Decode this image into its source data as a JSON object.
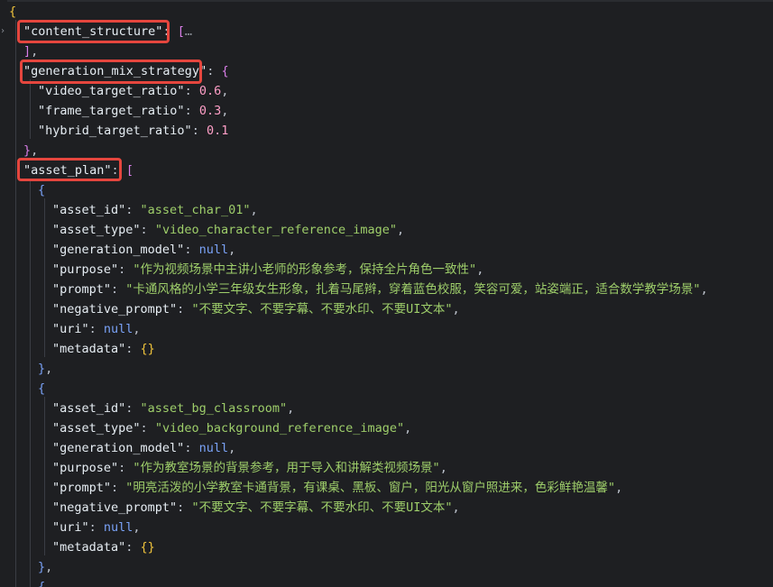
{
  "lines": [
    {
      "id": "l0",
      "parts": [
        {
          "t": "{",
          "c": "brace-y"
        }
      ]
    },
    {
      "id": "l1",
      "parts": [
        {
          "t": "\"content_structure\"",
          "c": "key"
        },
        {
          "t": ": ",
          "c": "punc"
        },
        {
          "t": "[",
          "c": "brack-p"
        },
        {
          "t": "…",
          "c": "ellipsis"
        }
      ]
    },
    {
      "id": "l2",
      "parts": [
        {
          "t": "]",
          "c": "brack-p"
        },
        {
          "t": ",",
          "c": "punc"
        }
      ]
    },
    {
      "id": "l3",
      "parts": [
        {
          "t": "\"generation_mix_strategy\"",
          "c": "key"
        },
        {
          "t": ": ",
          "c": "punc"
        },
        {
          "t": "{",
          "c": "brace-p"
        }
      ]
    },
    {
      "id": "l4",
      "parts": [
        {
          "t": "\"video_target_ratio\"",
          "c": "key"
        },
        {
          "t": ": ",
          "c": "punc"
        },
        {
          "t": "0.6",
          "c": "num"
        },
        {
          "t": ",",
          "c": "punc"
        }
      ]
    },
    {
      "id": "l5",
      "parts": [
        {
          "t": "\"frame_target_ratio\"",
          "c": "key"
        },
        {
          "t": ": ",
          "c": "punc"
        },
        {
          "t": "0.3",
          "c": "num"
        },
        {
          "t": ",",
          "c": "punc"
        }
      ]
    },
    {
      "id": "l6",
      "parts": [
        {
          "t": "\"hybrid_target_ratio\"",
          "c": "key"
        },
        {
          "t": ": ",
          "c": "punc"
        },
        {
          "t": "0.1",
          "c": "num"
        }
      ]
    },
    {
      "id": "l7",
      "parts": [
        {
          "t": "}",
          "c": "brace-p"
        },
        {
          "t": ",",
          "c": "punc"
        }
      ]
    },
    {
      "id": "l8",
      "parts": [
        {
          "t": "\"asset_plan\"",
          "c": "key"
        },
        {
          "t": ": ",
          "c": "punc"
        },
        {
          "t": "[",
          "c": "brack-p"
        }
      ]
    },
    {
      "id": "l9",
      "parts": [
        {
          "t": "{",
          "c": "brace-b"
        }
      ]
    },
    {
      "id": "l10",
      "parts": [
        {
          "t": "\"asset_id\"",
          "c": "key"
        },
        {
          "t": ": ",
          "c": "punc"
        },
        {
          "t": "\"asset_char_01\"",
          "c": "str"
        },
        {
          "t": ",",
          "c": "punc"
        }
      ]
    },
    {
      "id": "l11",
      "parts": [
        {
          "t": "\"asset_type\"",
          "c": "key"
        },
        {
          "t": ": ",
          "c": "punc"
        },
        {
          "t": "\"video_character_reference_image\"",
          "c": "str"
        },
        {
          "t": ",",
          "c": "punc"
        }
      ]
    },
    {
      "id": "l12",
      "parts": [
        {
          "t": "\"generation_model\"",
          "c": "key"
        },
        {
          "t": ": ",
          "c": "punc"
        },
        {
          "t": "null",
          "c": "nul"
        },
        {
          "t": ",",
          "c": "punc"
        }
      ]
    },
    {
      "id": "l13",
      "parts": [
        {
          "t": "\"purpose\"",
          "c": "key"
        },
        {
          "t": ": ",
          "c": "punc"
        },
        {
          "t": "\"作为视频场景中主讲小老师的形象参考，保持全片角色一致性\"",
          "c": "str"
        },
        {
          "t": ",",
          "c": "punc"
        }
      ]
    },
    {
      "id": "l14",
      "parts": [
        {
          "t": "\"prompt\"",
          "c": "key"
        },
        {
          "t": ": ",
          "c": "punc"
        },
        {
          "t": "\"卡通风格的小学三年级女生形象，扎着马尾辫，穿着蓝色校服，笑容可爱，站姿端正，适合数学教学场景\"",
          "c": "str"
        },
        {
          "t": ",",
          "c": "punc"
        }
      ]
    },
    {
      "id": "l15",
      "parts": [
        {
          "t": "\"negative_prompt\"",
          "c": "key"
        },
        {
          "t": ": ",
          "c": "punc"
        },
        {
          "t": "\"不要文字、不要字幕、不要水印、不要UI文本\"",
          "c": "str"
        },
        {
          "t": ",",
          "c": "punc"
        }
      ]
    },
    {
      "id": "l16",
      "parts": [
        {
          "t": "\"uri\"",
          "c": "key"
        },
        {
          "t": ": ",
          "c": "punc"
        },
        {
          "t": "null",
          "c": "nul"
        },
        {
          "t": ",",
          "c": "punc"
        }
      ]
    },
    {
      "id": "l17",
      "parts": [
        {
          "t": "\"metadata\"",
          "c": "key"
        },
        {
          "t": ": ",
          "c": "punc"
        },
        {
          "t": "{}",
          "c": "brace-y"
        }
      ]
    },
    {
      "id": "l18",
      "parts": [
        {
          "t": "}",
          "c": "brace-b"
        },
        {
          "t": ",",
          "c": "punc"
        }
      ]
    },
    {
      "id": "l19",
      "parts": [
        {
          "t": "{",
          "c": "brace-b"
        }
      ]
    },
    {
      "id": "l20",
      "parts": [
        {
          "t": "\"asset_id\"",
          "c": "key"
        },
        {
          "t": ": ",
          "c": "punc"
        },
        {
          "t": "\"asset_bg_classroom\"",
          "c": "str"
        },
        {
          "t": ",",
          "c": "punc"
        }
      ]
    },
    {
      "id": "l21",
      "parts": [
        {
          "t": "\"asset_type\"",
          "c": "key"
        },
        {
          "t": ": ",
          "c": "punc"
        },
        {
          "t": "\"video_background_reference_image\"",
          "c": "str"
        },
        {
          "t": ",",
          "c": "punc"
        }
      ]
    },
    {
      "id": "l22",
      "parts": [
        {
          "t": "\"generation_model\"",
          "c": "key"
        },
        {
          "t": ": ",
          "c": "punc"
        },
        {
          "t": "null",
          "c": "nul"
        },
        {
          "t": ",",
          "c": "punc"
        }
      ]
    },
    {
      "id": "l23",
      "parts": [
        {
          "t": "\"purpose\"",
          "c": "key"
        },
        {
          "t": ": ",
          "c": "punc"
        },
        {
          "t": "\"作为教室场景的背景参考，用于导入和讲解类视频场景\"",
          "c": "str"
        },
        {
          "t": ",",
          "c": "punc"
        }
      ]
    },
    {
      "id": "l24",
      "parts": [
        {
          "t": "\"prompt\"",
          "c": "key"
        },
        {
          "t": ": ",
          "c": "punc"
        },
        {
          "t": "\"明亮活泼的小学教室卡通背景，有课桌、黑板、窗户，阳光从窗户照进来，色彩鲜艳温馨\"",
          "c": "str"
        },
        {
          "t": ",",
          "c": "punc"
        }
      ]
    },
    {
      "id": "l25",
      "parts": [
        {
          "t": "\"negative_prompt\"",
          "c": "key"
        },
        {
          "t": ": ",
          "c": "punc"
        },
        {
          "t": "\"不要文字、不要字幕、不要水印、不要UI文本\"",
          "c": "str"
        },
        {
          "t": ",",
          "c": "punc"
        }
      ]
    },
    {
      "id": "l26",
      "parts": [
        {
          "t": "\"uri\"",
          "c": "key"
        },
        {
          "t": ": ",
          "c": "punc"
        },
        {
          "t": "null",
          "c": "nul"
        },
        {
          "t": ",",
          "c": "punc"
        }
      ]
    },
    {
      "id": "l27",
      "parts": [
        {
          "t": "\"metadata\"",
          "c": "key"
        },
        {
          "t": ": ",
          "c": "punc"
        },
        {
          "t": "{}",
          "c": "brace-y"
        }
      ]
    },
    {
      "id": "l28",
      "parts": [
        {
          "t": "}",
          "c": "brace-b"
        },
        {
          "t": ",",
          "c": "punc"
        }
      ]
    },
    {
      "id": "l29",
      "parts": [
        {
          "t": "{",
          "c": "brace-b"
        }
      ]
    }
  ],
  "icons": {
    "fold": "chevron-right-icon"
  },
  "colors": {
    "highlight": "#e5463e",
    "background": "#1e1f22"
  }
}
